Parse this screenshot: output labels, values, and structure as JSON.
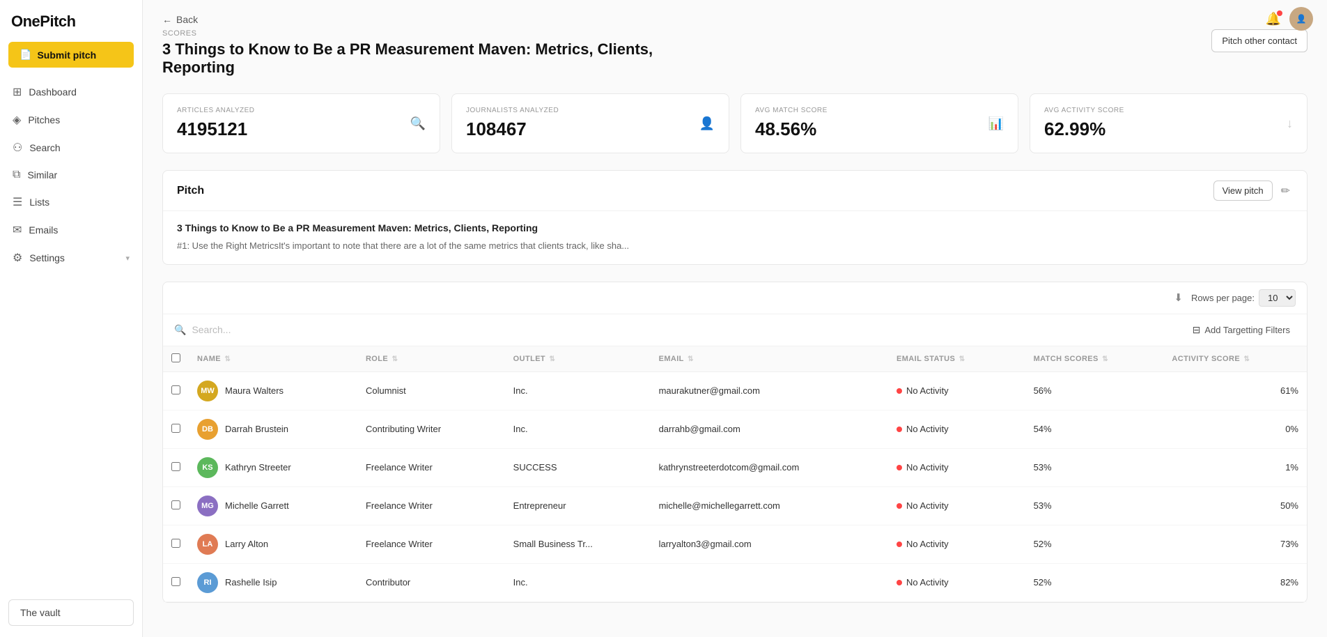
{
  "app": {
    "logo": "OnePitch"
  },
  "sidebar": {
    "submit_pitch_label": "Submit pitch",
    "nav_items": [
      {
        "id": "dashboard",
        "label": "Dashboard",
        "icon": "⊞"
      },
      {
        "id": "pitches",
        "label": "Pitches",
        "icon": "◈"
      },
      {
        "id": "search",
        "label": "Search",
        "icon": "⚇"
      },
      {
        "id": "similar",
        "label": "Similar",
        "icon": "⧉"
      },
      {
        "id": "lists",
        "label": "Lists",
        "icon": "☰"
      },
      {
        "id": "emails",
        "label": "Emails",
        "icon": "✉"
      },
      {
        "id": "settings",
        "label": "Settings",
        "icon": "⚙"
      }
    ],
    "vault_label": "The vault"
  },
  "header": {
    "back_label": "Back",
    "scores_label": "SCORES",
    "page_title": "3 Things to Know to Be a PR Measurement Maven: Metrics, Clients, Reporting",
    "pitch_other_label": "Pitch other contact"
  },
  "stats": [
    {
      "label": "ARTICLES ANALYZED",
      "value": "4195121",
      "icon": "search"
    },
    {
      "label": "JOURNALISTS ANALYZED",
      "value": "108467",
      "icon": "person"
    },
    {
      "label": "AVG MATCH SCORE",
      "value": "48.56%",
      "icon": "bar-chart"
    },
    {
      "label": "AVG ACTIVITY SCORE",
      "value": "62.99%",
      "icon": "activity"
    }
  ],
  "pitch_section": {
    "title": "Pitch",
    "view_pitch_label": "View pitch",
    "subject": "3 Things to Know to Be a PR Measurement Maven: Metrics, Clients, Reporting",
    "preview": "#1: Use the Right MetricsIt's important to note that there are a lot of the same metrics that clients track, like sha..."
  },
  "table": {
    "rows_per_page_label": "Rows per page:",
    "rows_per_page_value": "10",
    "search_placeholder": "Search...",
    "add_filter_label": "Add Targetting Filters",
    "columns": [
      {
        "id": "name",
        "label": "NAME"
      },
      {
        "id": "role",
        "label": "ROLE"
      },
      {
        "id": "outlet",
        "label": "OUTLET"
      },
      {
        "id": "email",
        "label": "EMAIL"
      },
      {
        "id": "email_status",
        "label": "EMAIL STATUS"
      },
      {
        "id": "match_scores",
        "label": "MATCH SCORES"
      },
      {
        "id": "activity_score",
        "label": "ACTIVITY SCORE"
      }
    ],
    "rows": [
      {
        "initials": "MW",
        "avatar_color": "#d4a820",
        "name": "Maura Walters",
        "role": "Columnist",
        "outlet": "Inc.",
        "email": "maurakutner@gmail.com",
        "email_status": "No Activity",
        "match_score": "56%",
        "activity_score": "61%"
      },
      {
        "initials": "DB",
        "avatar_color": "#e8a030",
        "name": "Darrah Brustein",
        "role": "Contributing Writer",
        "outlet": "Inc.",
        "email": "darrahb@gmail.com",
        "email_status": "No Activity",
        "match_score": "54%",
        "activity_score": "0%"
      },
      {
        "initials": "KS",
        "avatar_color": "#5cb85c",
        "name": "Kathryn Streeter",
        "role": "Freelance Writer",
        "outlet": "SUCCESS",
        "email": "kathrynstreeterdotcom@gmail.com",
        "email_status": "No Activity",
        "match_score": "53%",
        "activity_score": "1%"
      },
      {
        "initials": "MG",
        "avatar_color": "#8b6fc2",
        "name": "Michelle Garrett",
        "role": "Freelance Writer",
        "outlet": "Entrepreneur",
        "email": "michelle@michellegarrett.com",
        "email_status": "No Activity",
        "match_score": "53%",
        "activity_score": "50%"
      },
      {
        "initials": "LA",
        "avatar_color": "#e07b54",
        "name": "Larry Alton",
        "role": "Freelance Writer",
        "outlet": "Small Business Tr...",
        "email": "larryalton3@gmail.com",
        "email_status": "No Activity",
        "match_score": "52%",
        "activity_score": "73%"
      },
      {
        "initials": "RI",
        "avatar_color": "#5b9bd5",
        "name": "Rashelle Isip",
        "role": "Contributor",
        "outlet": "Inc.",
        "email": "",
        "email_status": "No Activity",
        "match_score": "52%",
        "activity_score": "82%"
      }
    ]
  }
}
